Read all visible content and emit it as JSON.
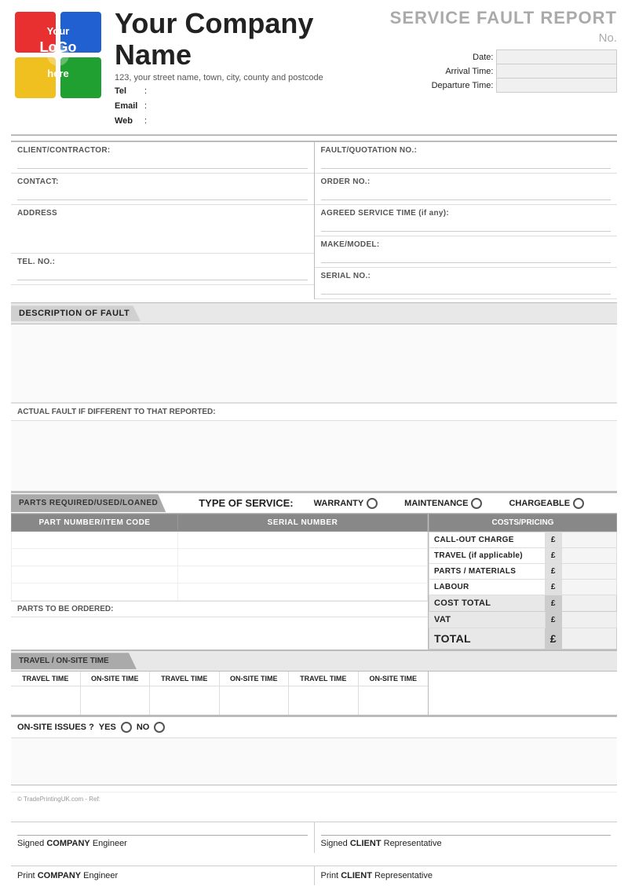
{
  "company": {
    "logo_text": "Your LoGo here",
    "name": "Your Company Name",
    "address": "123, your street name, town, city, county and postcode",
    "tel_label": "Tel",
    "tel_colon": ":",
    "email_label": "Email",
    "email_colon": ":",
    "web_label": "Web",
    "web_colon": ":"
  },
  "report": {
    "title": "SERVICE FAULT REPORT",
    "no_label": "No."
  },
  "date_fields": {
    "date_label": "Date:",
    "arrival_label": "Arrival Time:",
    "departure_label": "Departure Time:"
  },
  "form_fields": {
    "client_label": "CLIENT/CONTRACTOR:",
    "contact_label": "CONTACT:",
    "address_label": "ADDRESS",
    "tel_no_label": "TEL. NO.:",
    "fault_quotation_label": "FAULT/QUOTATION NO.:",
    "order_no_label": "ORDER NO.:",
    "agreed_service_label": "AGREED SERVICE TIME (if any):",
    "make_model_label": "MAKE/MODEL:",
    "serial_no_label": "SERIAL NO.:"
  },
  "sections": {
    "description_of_fault": "DESCRIPTION OF FAULT",
    "actual_fault_label": "ACTUAL FAULT IF DIFFERENT TO THAT REPORTED:",
    "parts_required_label": "PARTS REQUIRED/USED/LOANED",
    "type_of_service_label": "TYPE OF SERVICE:",
    "warranty_label": "WARRANTY",
    "maintenance_label": "MAINTENANCE",
    "chargeable_label": "CHARGEABLE",
    "part_number_header": "PART NUMBER/ITEM CODE",
    "serial_number_header": "SERIAL NUMBER",
    "costs_header": "COSTS/PRICING",
    "call_out_label": "CALL-OUT CHARGE",
    "travel_label": "TRAVEL (if applicable)",
    "parts_materials_label": "PARTS / MATERIALS",
    "labour_label": "LABOUR",
    "cost_total_label": "COST TOTAL",
    "vat_label": "VAT",
    "total_label": "TOTAL",
    "currency_symbol": "£",
    "parts_to_order_label": "PARTS TO BE ORDERED:",
    "travel_onsite_label": "TRAVEL / ON-SITE TIME",
    "travel_time_label": "TRAVEL TIME",
    "onsite_time_label": "ON-SITE TIME",
    "onsite_issues_label": "ON-SITE ISSUES ?",
    "yes_label": "YES",
    "no_label_2": "NO"
  },
  "signatures": {
    "copyright": "© TradePrintingUK.com - Ref:",
    "signed_company_label": "Signed",
    "company_bold": "COMPANY",
    "engineer_label": "Engineer",
    "signed_client_label": "Signed",
    "client_bold": "CLIENT",
    "representative_label": "Representative",
    "print_company_label": "Print",
    "print_company_bold": "COMPANY",
    "print_engineer_label": "Engineer",
    "print_client_label": "Print",
    "print_client_bold": "CLIENT",
    "print_rep_label": "Representative"
  }
}
